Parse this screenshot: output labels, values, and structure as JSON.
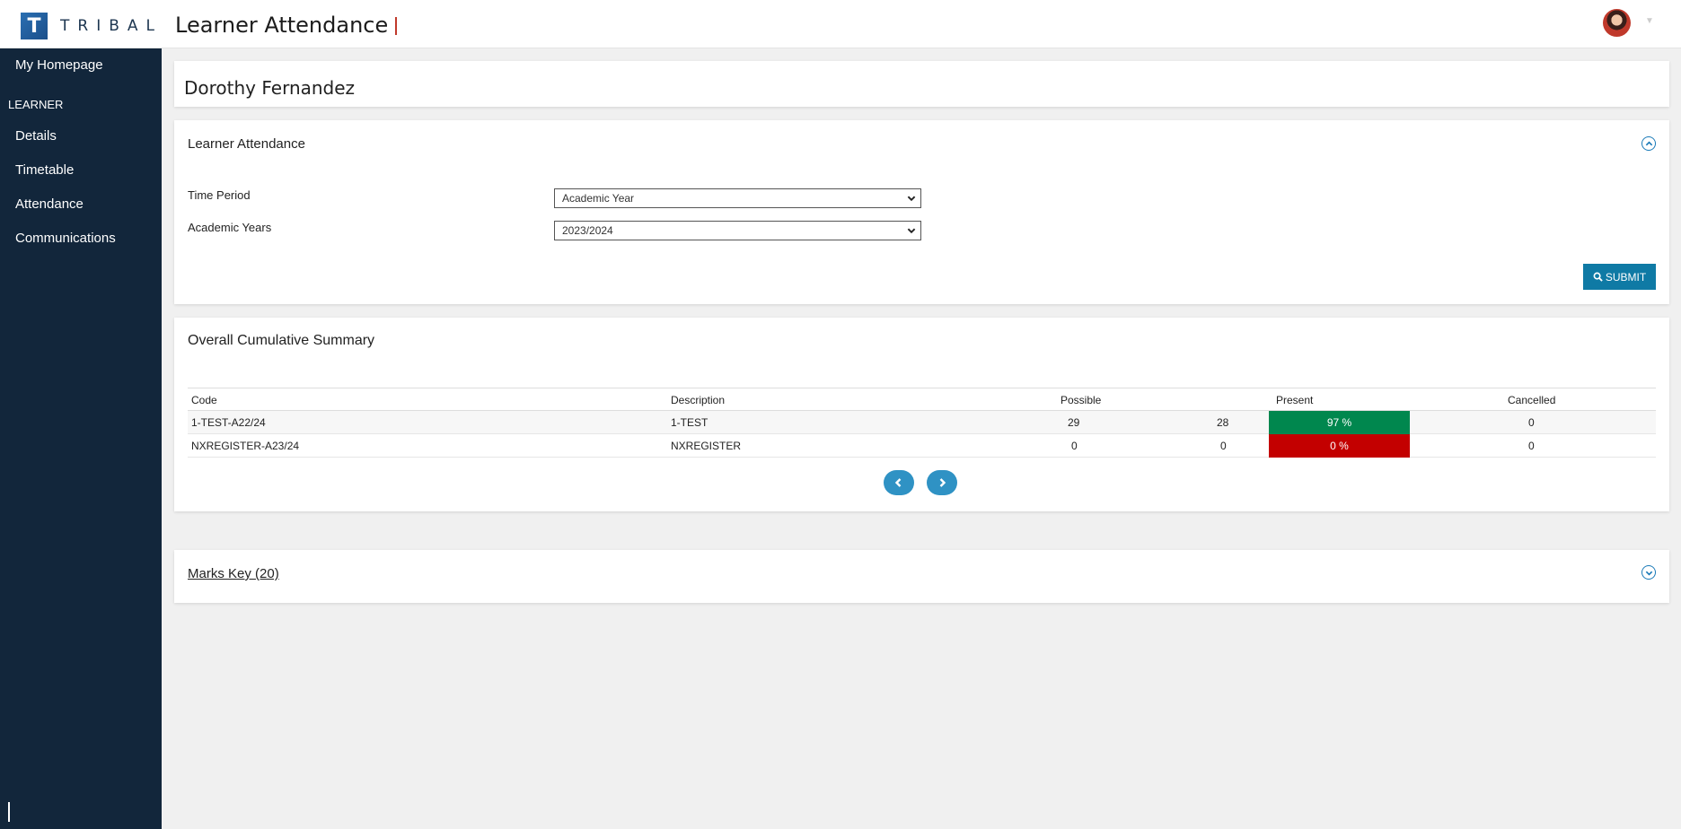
{
  "brand": {
    "logo_letter": "T",
    "logo_text": "TRIBAL"
  },
  "header": {
    "title": "Learner Attendance"
  },
  "sidebar": {
    "home": "My Homepage",
    "section": "LEARNER",
    "items": [
      {
        "label": "Details"
      },
      {
        "label": "Timetable"
      },
      {
        "label": "Attendance"
      },
      {
        "label": "Communications"
      }
    ]
  },
  "learner": {
    "name": "Dorothy Fernandez"
  },
  "attendance_panel": {
    "title": "Learner Attendance",
    "time_period_label": "Time Period",
    "time_period_value": "Academic Year",
    "academic_years_label": "Academic Years",
    "academic_years_value": "2023/2024",
    "submit_label": "SUBMIT"
  },
  "summary": {
    "title": "Overall Cumulative Summary",
    "columns": {
      "code": "Code",
      "description": "Description",
      "possible": "Possible",
      "present": "Present",
      "cancelled": "Cancelled"
    },
    "rows": [
      {
        "code": "1-TEST-A22/24",
        "description": "1-TEST",
        "possible": "29",
        "present_count": "28",
        "present_pct": "97 %",
        "cancelled": "0",
        "status_color": "#00874e"
      },
      {
        "code": "NXREGISTER-A23/24",
        "description": "NXREGISTER",
        "possible": "0",
        "present_count": "0",
        "present_pct": "0 %",
        "cancelled": "0",
        "status_color": "#c30000"
      }
    ]
  },
  "marks_key": {
    "label": "Marks Key (20)"
  },
  "colors": {
    "sidebar": "#12263b",
    "accent": "#0f7aa5",
    "good": "#00874e",
    "bad": "#c30000"
  }
}
